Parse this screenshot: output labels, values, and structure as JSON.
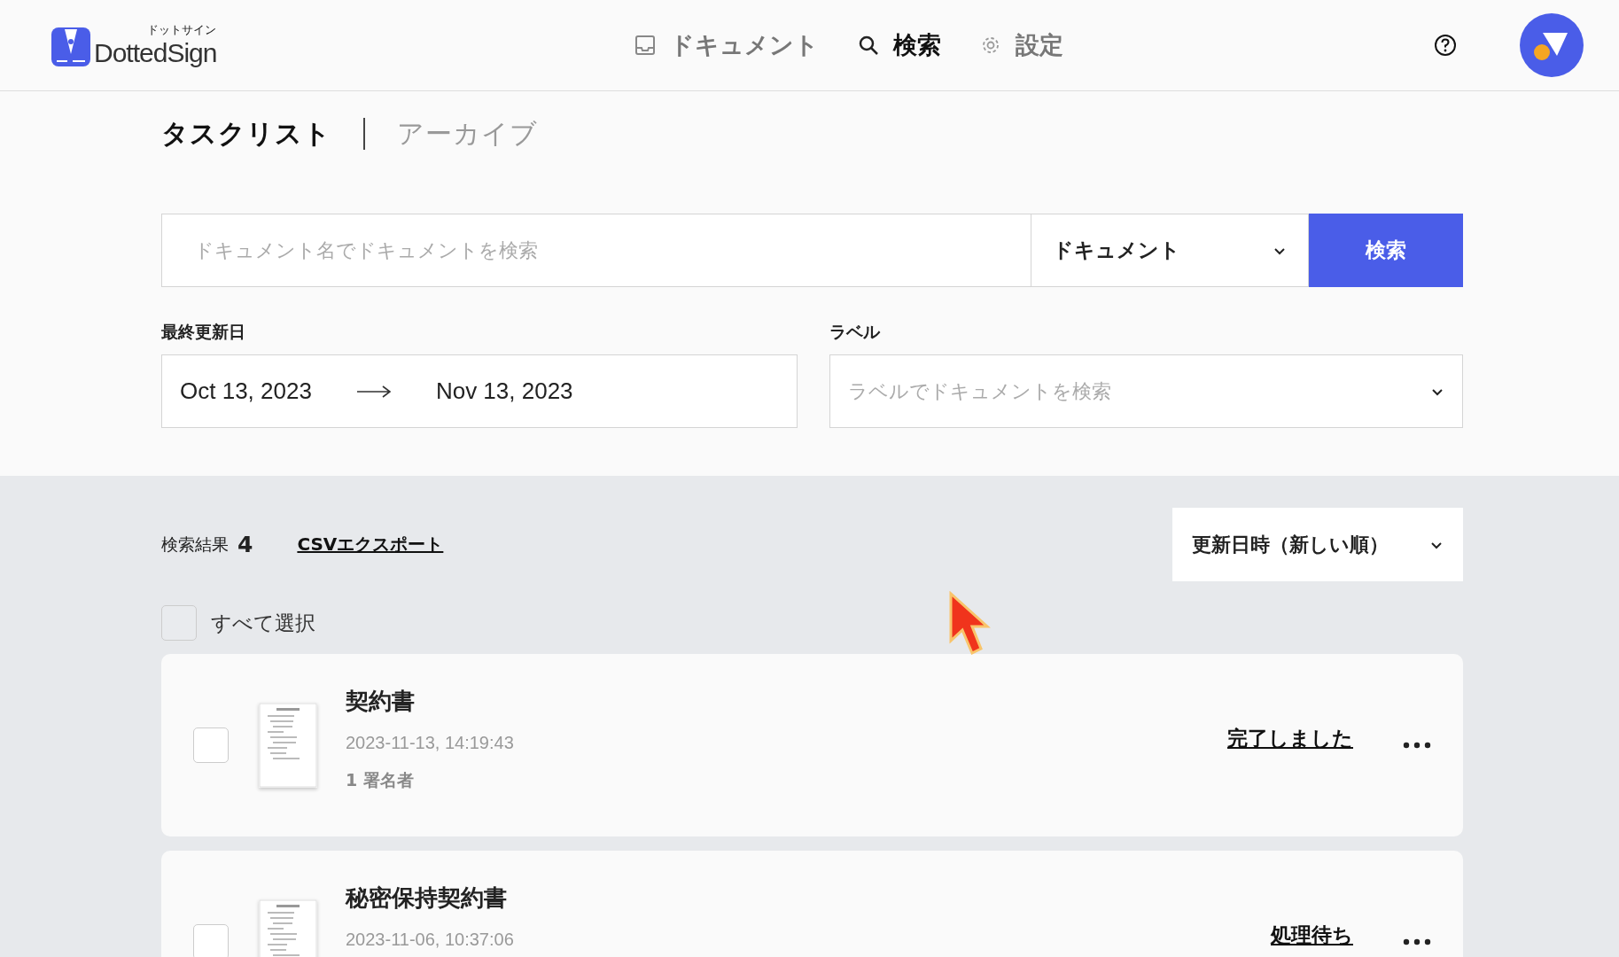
{
  "header": {
    "logo": {
      "text": "DottedSign",
      "subtitle": "ドットサイン"
    },
    "nav": [
      {
        "label": "ドキュメント",
        "selected": false
      },
      {
        "label": "検索",
        "selected": true
      },
      {
        "label": "設定",
        "selected": false
      }
    ]
  },
  "tabs": [
    {
      "label": "タスクリスト",
      "selected": true
    },
    {
      "label": "アーカイブ",
      "selected": false
    }
  ],
  "search": {
    "placeholder": "ドキュメント名でドキュメントを検索",
    "scope": "ドキュメント",
    "button": "検索"
  },
  "filters": {
    "date_label": "最終更新日",
    "date_from": "Oct 13, 2023",
    "date_to": "Nov 13, 2023",
    "label_label": "ラベル",
    "label_placeholder": "ラベルでドキュメントを検索"
  },
  "results": {
    "label": "検索結果",
    "count": "4",
    "export": "CSVエクスポート",
    "sort": "更新日時（新しい順）",
    "select_all": "すべて選択",
    "select_all_checked": false
  },
  "documents": [
    {
      "title": "契約書",
      "date": "2023-11-13, 14:19:43",
      "signers": "1 署名者",
      "status": "完了しました",
      "checked": false
    },
    {
      "title": "秘密保持契約書",
      "date": "2023-11-06, 10:37:06",
      "status": "処理待ち",
      "checked": false
    }
  ]
}
